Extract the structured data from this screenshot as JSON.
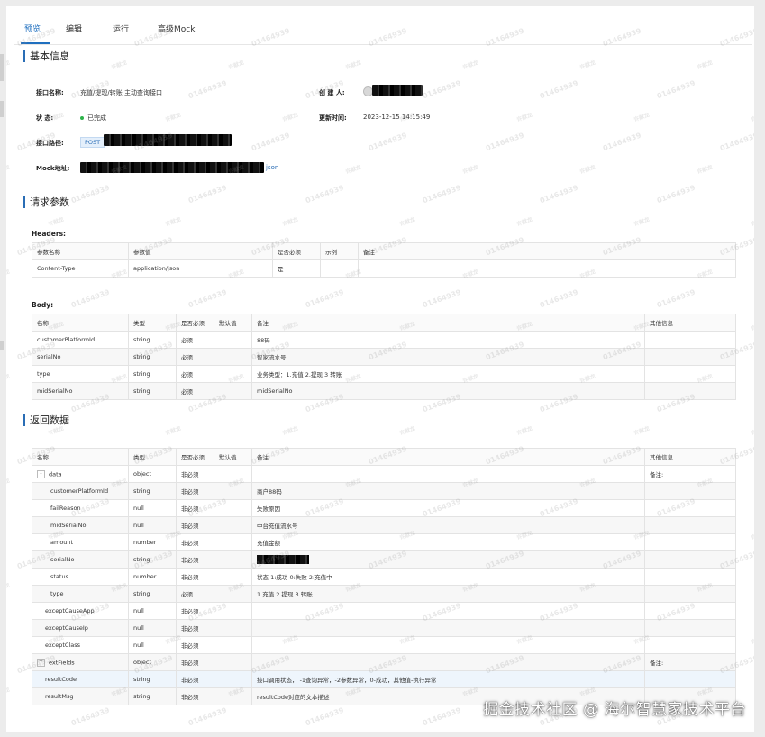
{
  "tabs": [
    "预览",
    "编辑",
    "运行",
    "高级Mock"
  ],
  "basic": {
    "title": "基本信息",
    "name_label": "接口名称:",
    "name_value": "充值/提现/转账 主动查询接口",
    "creator_label": "创 建 人:",
    "status_label": "状 态:",
    "status_value": "已完成",
    "updated_label": "更新时间:",
    "updated_value": "2023-12-15 14:15:49",
    "path_label": "接口路径:",
    "method": "POST",
    "mock_label": "Mock地址:",
    "mock_tail": "json"
  },
  "request": {
    "title": "请求参数",
    "headers_label": "Headers:",
    "headers_columns": [
      "参数名称",
      "参数值",
      "是否必须",
      "示例",
      "备注"
    ],
    "headers_rows": [
      [
        "Content-Type",
        "application/json",
        "是",
        "",
        ""
      ]
    ],
    "body_label": "Body:",
    "body_columns": [
      "名称",
      "类型",
      "是否必须",
      "默认值",
      "备注",
      "其他信息"
    ],
    "body_rows": [
      [
        "customerPlatformId",
        "string",
        "必须",
        "",
        "88码",
        ""
      ],
      [
        "serialNo",
        "string",
        "必须",
        "",
        "智家流水号",
        ""
      ],
      [
        "type",
        "string",
        "必须",
        "",
        "业务类型：1.充值 2.提现 3 转账",
        ""
      ],
      [
        "midSerialNo",
        "string",
        "必须",
        "",
        "midSerialNo",
        ""
      ]
    ]
  },
  "response": {
    "title": "返回数据",
    "columns": [
      "名称",
      "类型",
      "是否必须",
      "默认值",
      "备注",
      "其他信息"
    ],
    "rows": [
      {
        "name": "data",
        "type": "object",
        "req": "非必须",
        "def": "",
        "note": "",
        "other": "备注:",
        "level": 0,
        "toggle": "-"
      },
      {
        "name": "customerPlatformId",
        "type": "string",
        "req": "非必须",
        "def": "",
        "note": "商户88码",
        "other": "",
        "level": 1
      },
      {
        "name": "failReason",
        "type": "null",
        "req": "非必须",
        "def": "",
        "note": "失败原因",
        "other": "",
        "level": 1
      },
      {
        "name": "midSerialNo",
        "type": "null",
        "req": "非必须",
        "def": "",
        "note": "中台充值流水号",
        "other": "",
        "level": 1
      },
      {
        "name": "amount",
        "type": "number",
        "req": "非必须",
        "def": "",
        "note": "充值金额",
        "other": "",
        "level": 1
      },
      {
        "name": "serialNo",
        "type": "string",
        "req": "非必须",
        "def": "",
        "note": "",
        "other": "",
        "level": 1,
        "redacted": true
      },
      {
        "name": "status",
        "type": "number",
        "req": "非必须",
        "def": "",
        "note": "状态 1:成功 0:失败 2:充值中",
        "other": "",
        "level": 1
      },
      {
        "name": "type",
        "type": "string",
        "req": "必须",
        "def": "",
        "note": "1.充值 2.提现 3 转账",
        "other": "",
        "level": 1
      },
      {
        "name": "exceptCauseApp",
        "type": "null",
        "req": "非必须",
        "def": "",
        "note": "",
        "other": "",
        "level": 0
      },
      {
        "name": "exceptCauseIp",
        "type": "null",
        "req": "非必须",
        "def": "",
        "note": "",
        "other": "",
        "level": 0
      },
      {
        "name": "exceptClass",
        "type": "null",
        "req": "非必须",
        "def": "",
        "note": "",
        "other": "",
        "level": 0
      },
      {
        "name": "extFields",
        "type": "object",
        "req": "非必须",
        "def": "",
        "note": "",
        "other": "备注:",
        "level": 0,
        "toggle": "+"
      },
      {
        "name": "resultCode",
        "type": "string",
        "req": "非必须",
        "def": "",
        "note": "接口调用状态， -1查询异常，-2参数异常，0-成功，其他值-执行异常",
        "other": "",
        "level": 0,
        "highlight": true
      },
      {
        "name": "resultMsg",
        "type": "string",
        "req": "非必须",
        "def": "",
        "note": "resultCode对应的文本描述",
        "other": "",
        "level": 0
      }
    ]
  },
  "watermark": {
    "id": "01464939",
    "name": "许献龙"
  },
  "credit": "掘金技术社区 @ 海尔智慧家技术平台",
  "colors": {
    "accent": "#2a6db5",
    "success": "#2db34a"
  }
}
